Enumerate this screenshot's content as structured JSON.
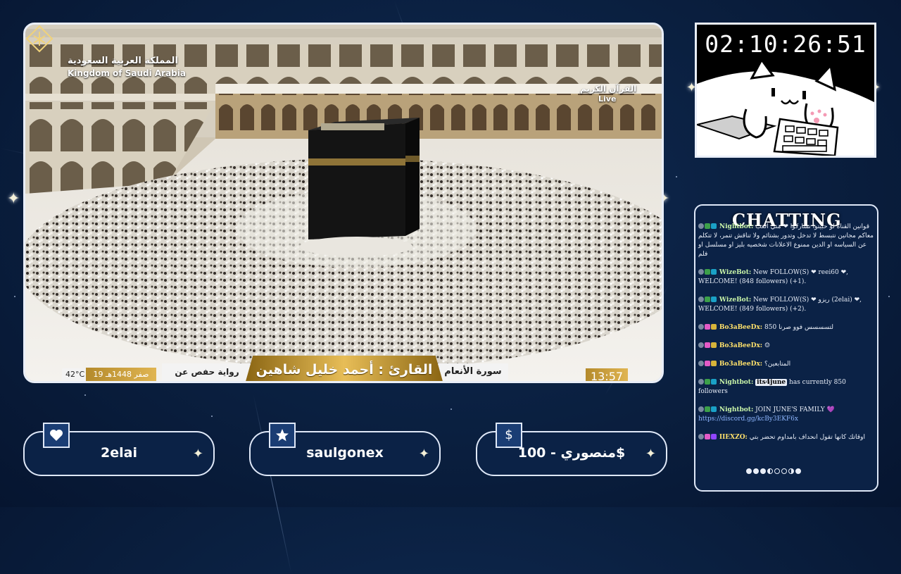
{
  "broadcast": {
    "logo_ar": "المملكة العربية السعودية",
    "logo_en": "Kingdom of Saudi Arabia",
    "channel_name": "القرآن الكريم",
    "channel_live": "Live",
    "lower_third": {
      "temperature": "42°C",
      "hijri_date": "19 صفر 1448هـ",
      "riwaya": "رواية حفص عن عاصم",
      "qari": "القارئ : أحمد خليل شاهين",
      "surah": "سورة الأنعام",
      "clock": "13:57"
    }
  },
  "timer": {
    "value": "02:10:26:51"
  },
  "chat": {
    "title": "CHATTING",
    "messages": [
      {
        "user": "Nightbot:",
        "text": "قوانين القناه لو حبيتوا تشاركوا ❤ مني العب معاكم مجانين نتبسط لا تدخل وتدور بشتائم ولا تناقش تنمر، لا تتكلم عن السياسه او الدين ممنوع الاعلانات شخصيه بليز او مسلسل او فلم"
      },
      {
        "user": "WizeBot:",
        "text": "New FOLLOW(S) ❤ reei60 ❤, WELCOME! (848 followers) (+1)."
      },
      {
        "user": "WizeBot:",
        "text": "New FOLLOW(S) ❤ ريزو (2elai) ❤, WELCOME! (849 followers) (+2)."
      },
      {
        "user": "Bo3aBeeDx:",
        "text": "لتسسسس فوو صرنا 850"
      },
      {
        "user": "Bo3aBeeDx:",
        "text": "☺"
      },
      {
        "user": "Bo3aBeeDx:",
        "text": "المتابعين؟"
      },
      {
        "user": "Nightbot:",
        "chip": "its4june",
        "text": "has currently 850 followers"
      },
      {
        "user": "Nightbot:",
        "text": "JOIN JUNE'S FAMILY 💜",
        "link": "https://discord.gg/kcBy3EKF6x"
      },
      {
        "user": "IIEXZO:",
        "text": "اوقاتك كانها تقول انحداف بامداوم تحضر بتي"
      }
    ]
  },
  "alerts": [
    {
      "icon": "heart-icon",
      "label": "2elai"
    },
    {
      "icon": "star-icon",
      "label": "saulgonex"
    },
    {
      "icon": "dollar-icon",
      "glyph": "$",
      "label": "منصوري - 100$"
    }
  ]
}
